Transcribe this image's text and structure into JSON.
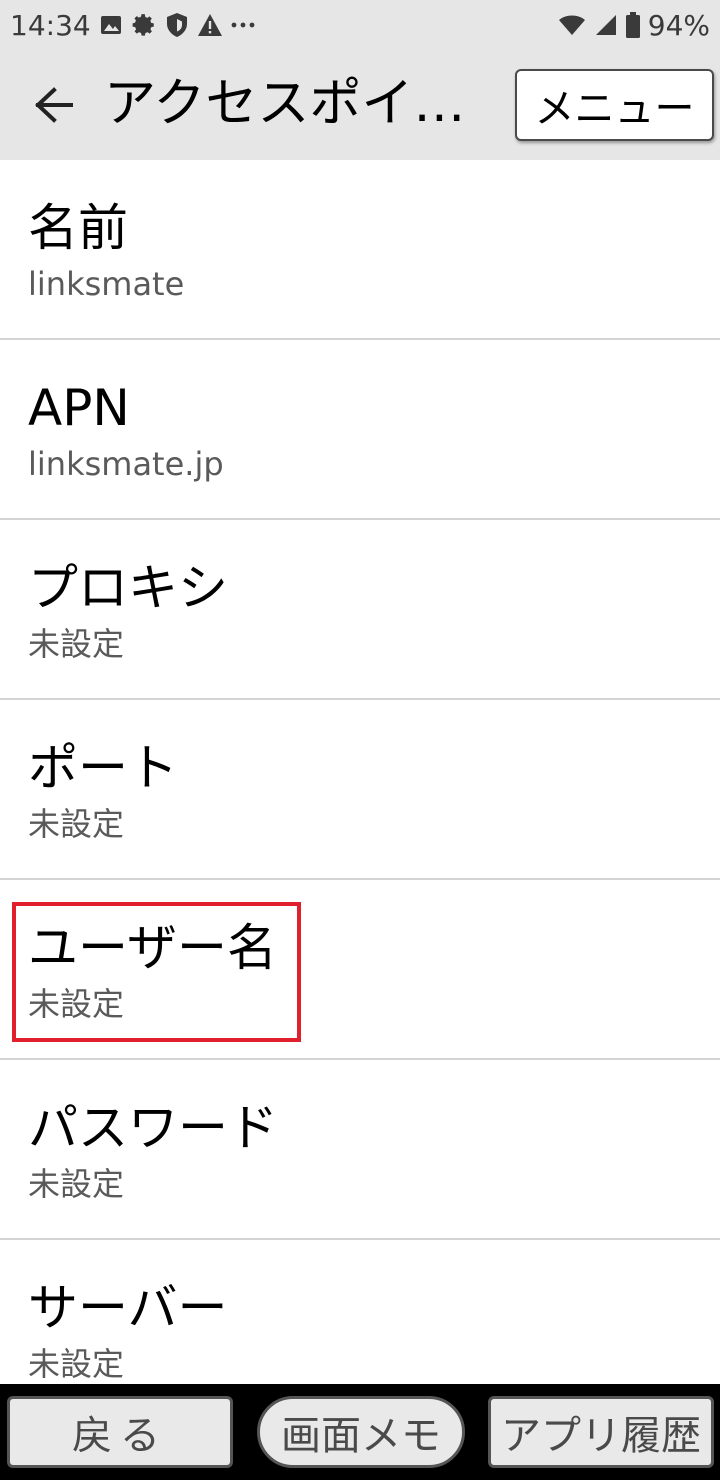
{
  "status_bar": {
    "time": "14:34",
    "battery_percent": "94%",
    "left_icons": [
      "image-icon",
      "gear-icon",
      "shield-icon",
      "warning-icon",
      "more-dots-icon"
    ],
    "right_icons": [
      "wifi-icon",
      "cellular-signal-icon",
      "battery-icon"
    ]
  },
  "app_bar": {
    "title": "アクセスポイ…",
    "menu_label": "メニュー",
    "back_icon": "arrow-left-icon"
  },
  "items": [
    {
      "title": "名前",
      "value": "linksmate"
    },
    {
      "title": "APN",
      "value": "linksmate.jp"
    },
    {
      "title": "プロキシ",
      "value": "未設定"
    },
    {
      "title": "ポート",
      "value": "未設定"
    },
    {
      "title": "ユーザー名",
      "value": "未設定"
    },
    {
      "title": "パスワード",
      "value": "未設定"
    },
    {
      "title": "サーバー",
      "value": "未設定"
    }
  ],
  "highlight": {
    "item_index": 4,
    "color": "#e0202c"
  },
  "bottom_nav": {
    "back_label": "戻る",
    "memo_label": "画面メモ",
    "history_label": "アプリ履歴"
  },
  "colors": {
    "bar_background": "#e6e6e6",
    "divider": "#d4d4d4",
    "secondary_text": "#5a5a5a"
  }
}
